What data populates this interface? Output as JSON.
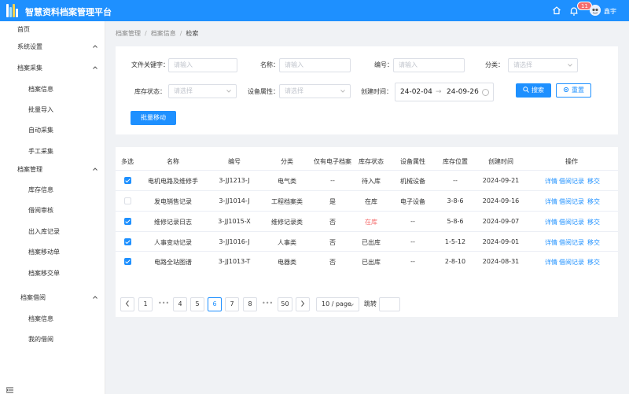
{
  "app": {
    "title": "智慧资料档案管理平台",
    "user": "鑫宇",
    "notification_count": "11"
  },
  "sidebar": {
    "items": [
      {
        "label": "首页"
      },
      {
        "label": "系统设置"
      },
      {
        "label": "档案采集"
      },
      {
        "label": "档案信息"
      },
      {
        "label": "批量导入"
      },
      {
        "label": "自动采集"
      },
      {
        "label": "手工采集"
      },
      {
        "label": "档案管理"
      },
      {
        "label": "库存信息"
      },
      {
        "label": "借阅审核"
      },
      {
        "label": "出入库记录"
      },
      {
        "label": "档案移动单"
      },
      {
        "label": "档案移交单"
      },
      {
        "label": "档案借阅"
      },
      {
        "label": "档案信息"
      },
      {
        "label": "我的借阅"
      }
    ]
  },
  "breadcrumb": [
    "档案管理",
    "档案信息",
    "检索"
  ],
  "filters": {
    "keyword": {
      "label": "文件关键字：",
      "placeholder": "请输入"
    },
    "name": {
      "label": "名称：",
      "placeholder": "请输入"
    },
    "code": {
      "label": "编号：",
      "placeholder": "请输入"
    },
    "category": {
      "label": "分类：",
      "placeholder": "请选择"
    },
    "stock_status": {
      "label": "库存状态：",
      "placeholder": "请选择"
    },
    "device_attr": {
      "label": "设备属性：",
      "placeholder": "请选择"
    },
    "created": {
      "label": "创建时间：",
      "start": "24-02-04",
      "separator": "→",
      "end": "24-09-26"
    }
  },
  "actions": {
    "search": "搜索",
    "reset": "重置",
    "batch_move": "批量移动"
  },
  "table": {
    "headers": [
      "多选",
      "名称",
      "编号",
      "分类",
      "仅有电子档案",
      "库存状态",
      "设备属性",
      "库存位置",
      "创建时间",
      "操作"
    ],
    "rows": [
      {
        "checked": true,
        "name": "电机电路及维修手",
        "code": "3-JJ1213-J",
        "category": "电气类",
        "electronic_only": "--",
        "status": "待入库",
        "device": "机械设备",
        "location": "--",
        "created": "2024-09-21"
      },
      {
        "checked": false,
        "name": "发电销售记录",
        "code": "3-JJ1014-J",
        "category": "工程档案类",
        "electronic_only": "是",
        "status": "在库",
        "device": "电子设备",
        "location": "3-8-6",
        "created": "2024-09-16"
      },
      {
        "checked": true,
        "name": "维修记录日志",
        "code": "3-JJ1015-X",
        "category": "维修记录类",
        "electronic_only": "否",
        "status": "在库",
        "device": "--",
        "location": "5-8-6",
        "created": "2024-09-07"
      },
      {
        "checked": true,
        "name": "人事变动记录",
        "code": "3-JJ1016-J",
        "category": "人事类",
        "electronic_only": "否",
        "status": "已出库",
        "device": "--",
        "location": "1-5-12",
        "created": "2024-09-01"
      },
      {
        "checked": true,
        "name": "电路全站图谱",
        "code": "3-JJ1013-T",
        "category": "电器类",
        "electronic_only": "否",
        "status": "已出库",
        "device": "--",
        "location": "2-8-10",
        "created": "2024-08-31"
      }
    ],
    "op_labels": [
      "详情",
      "借阅记录",
      "移交"
    ]
  },
  "pagination": {
    "pages": [
      "1",
      "4",
      "5",
      "6",
      "7",
      "8",
      "50"
    ],
    "ellipsis": "•••",
    "current": "6",
    "page_size": "10 / page",
    "jump_label": "跳转"
  },
  "colors": {
    "primary": "#1e90ff",
    "danger": "#f56c6c",
    "page_bg": "#f0f2f5"
  }
}
